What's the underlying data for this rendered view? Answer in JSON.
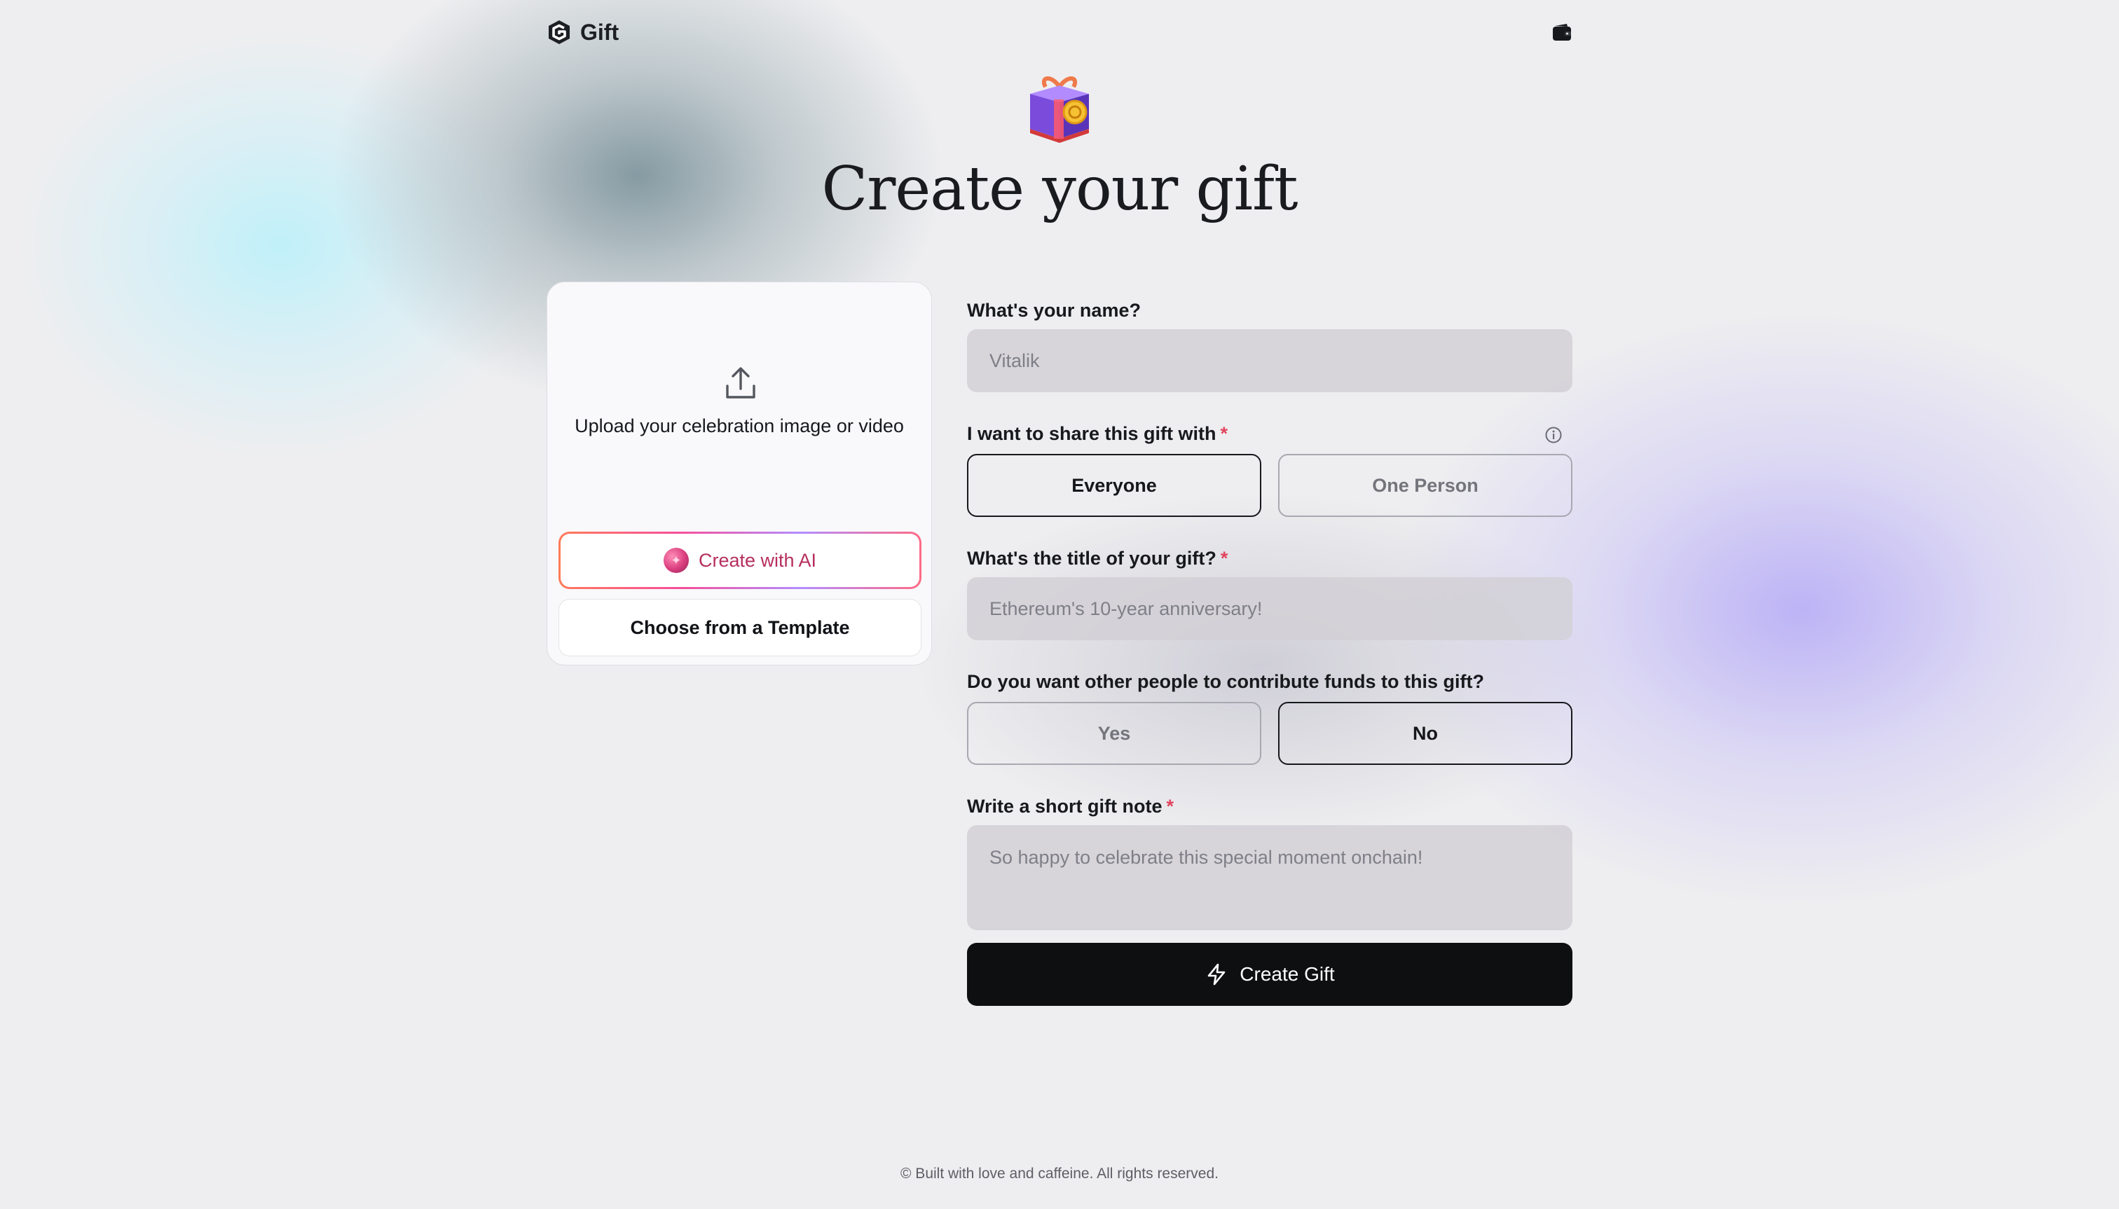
{
  "header": {
    "logo_text": "Gift",
    "logo_icon": "gift-logo-icon",
    "wallet_icon": "wallet-icon"
  },
  "hero": {
    "icon": "gift-box-icon",
    "title": "Create your gift"
  },
  "media": {
    "upload_icon": "upload-icon",
    "upload_label": "Upload your celebration image or video",
    "ai_button_label": "Create with AI",
    "template_button_label": "Choose from a Template"
  },
  "form": {
    "name": {
      "label": "What's your name?",
      "placeholder": "Vitalik"
    },
    "share": {
      "label": "I want to share this gift with",
      "required_mark": "*",
      "options": [
        "Everyone",
        "One Person"
      ],
      "selected": "Everyone"
    },
    "title": {
      "label": "What's the title of your gift?",
      "required_mark": "*",
      "placeholder": "Ethereum's 10-year anniversary!"
    },
    "contribute": {
      "label": "Do you want other people to contribute funds to this gift?",
      "options": [
        "Yes",
        "No"
      ],
      "selected": "No"
    },
    "note": {
      "label": "Write a short gift note",
      "required_mark": "*",
      "placeholder": "So happy to celebrate this special moment onchain!"
    },
    "submit_label": "Create Gift"
  },
  "footer": {
    "text": "© Built with love and caffeine. All rights reserved."
  },
  "colors": {
    "background": "#eeeef0",
    "primary_button": "#0e0f11",
    "required": "#e2455e",
    "ai_accent": "#b62f5f"
  }
}
